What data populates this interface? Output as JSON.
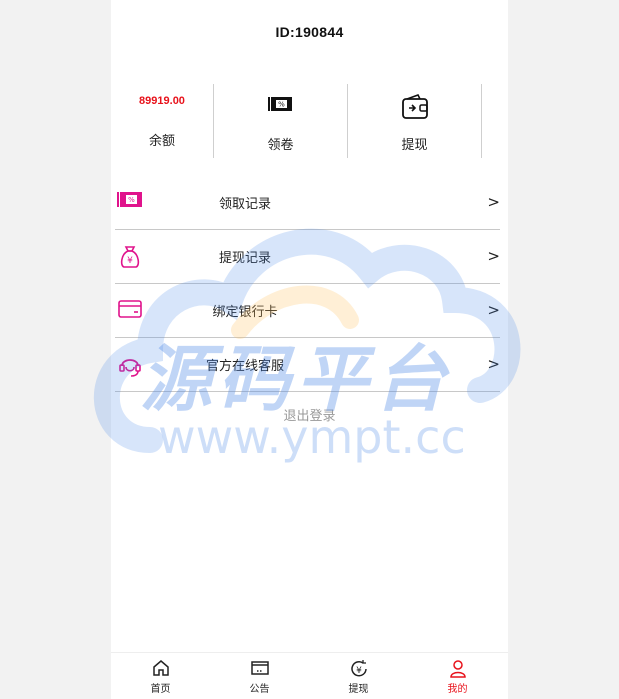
{
  "header": {
    "user_id": "ID:190844"
  },
  "stats": {
    "balance_value": "89919.00",
    "balance_label": "余额",
    "coupon_label": "领卷",
    "withdraw_label": "提现"
  },
  "menu": {
    "items": [
      {
        "label": "领取记录",
        "icon": "coupon-icon"
      },
      {
        "label": "提现记录",
        "icon": "money-bag-icon"
      },
      {
        "label": "绑定银行卡",
        "icon": "bank-card-icon"
      },
      {
        "label": "官方在线客服",
        "icon": "headset-icon"
      }
    ],
    "arrow": ">"
  },
  "logout_label": "退出登录",
  "watermark": {
    "title": "源码平台",
    "url": "www.ympt.cc"
  },
  "tabbar": {
    "tabs": [
      {
        "label": "首页",
        "icon": "home-icon"
      },
      {
        "label": "公告",
        "icon": "notice-icon"
      },
      {
        "label": "提现",
        "icon": "yuan-icon"
      },
      {
        "label": "我的",
        "icon": "user-icon"
      }
    ],
    "active_index": 3
  },
  "colors": {
    "accent": "#e8121b",
    "icon_pink": "#e0138c",
    "watermark": "#4a88e6"
  }
}
